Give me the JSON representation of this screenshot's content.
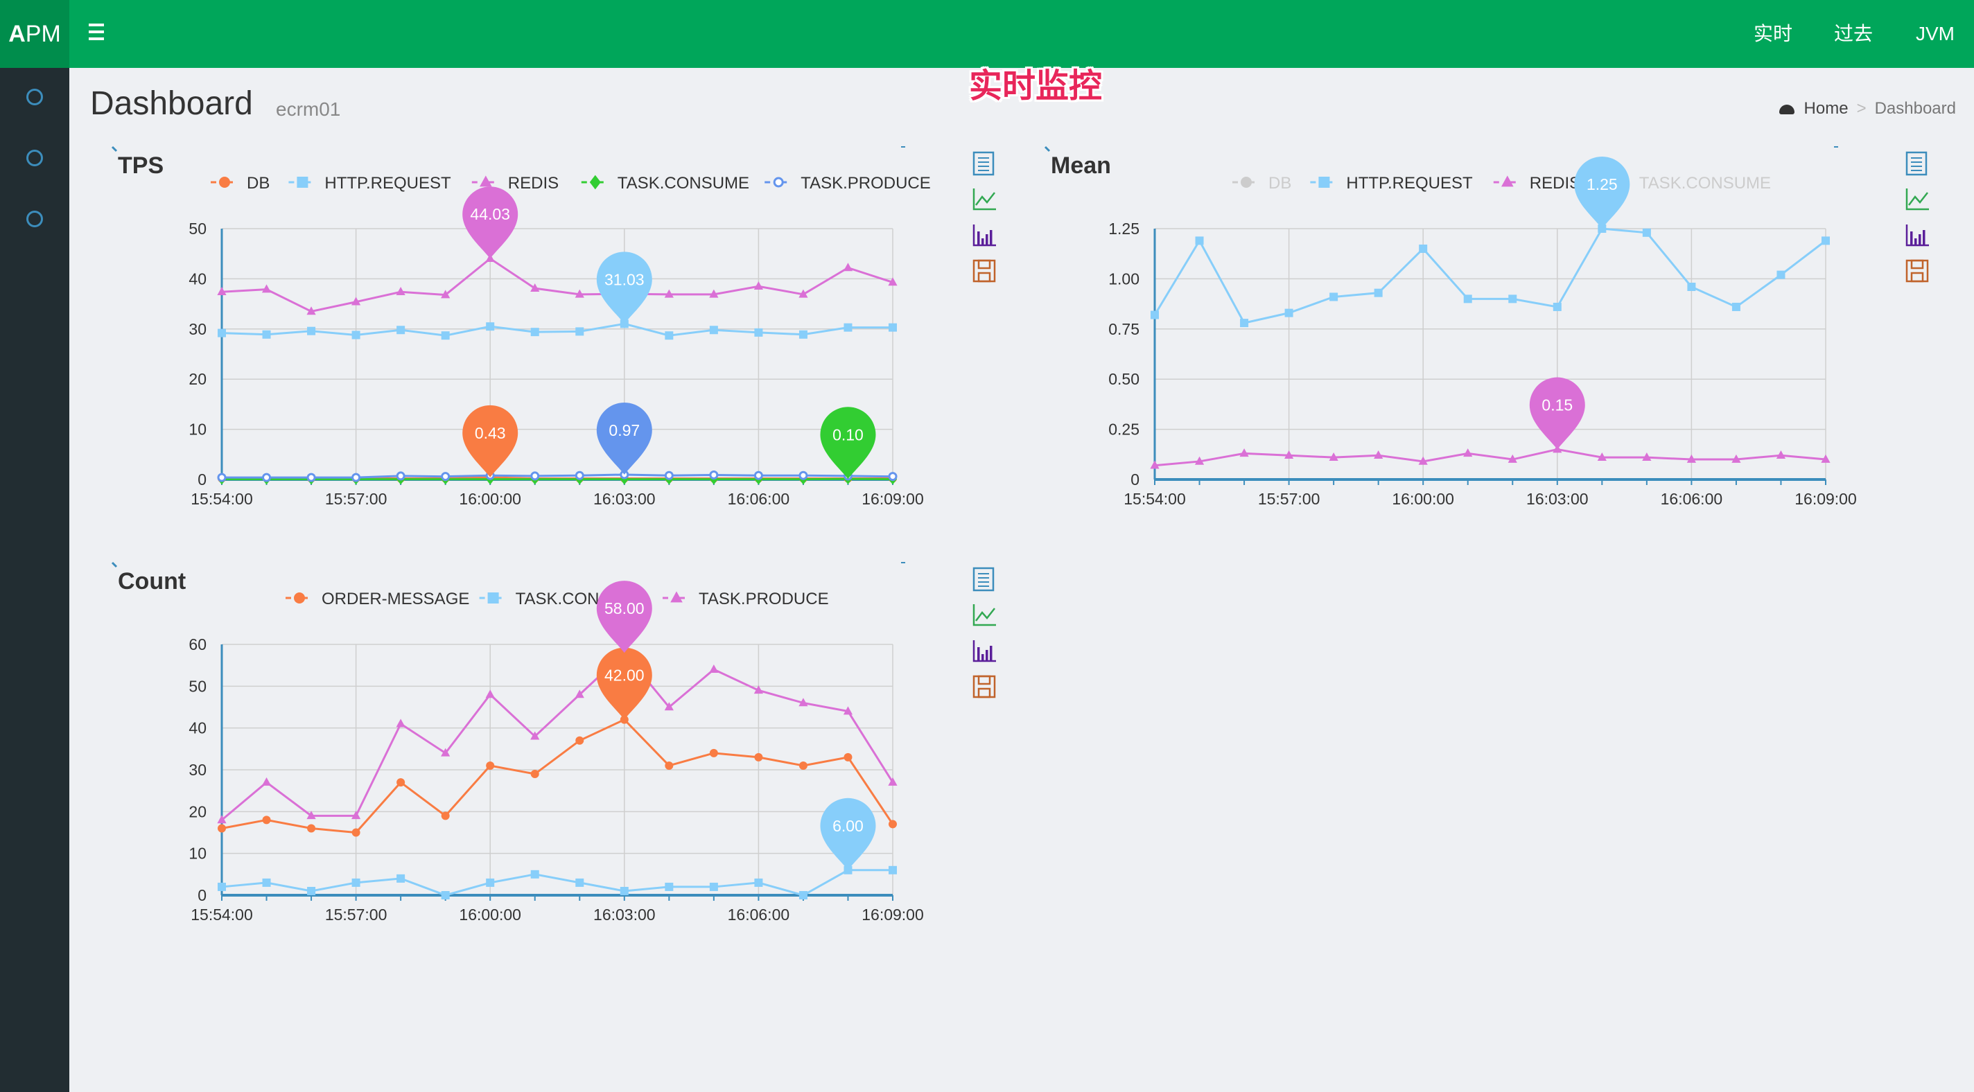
{
  "app": {
    "logo_a": "A",
    "logo_rest": "PM"
  },
  "nav": [
    "实时",
    "过去",
    "JVM"
  ],
  "overlay_label": "实时监控",
  "page": {
    "title": "Dashboard",
    "subtitle": "ecrm01"
  },
  "breadcrumb": {
    "home": "Home",
    "current": "Dashboard"
  },
  "toolbox": [
    "data-view-icon",
    "line-chart-icon",
    "bar-chart-icon",
    "save-image-icon"
  ],
  "chart_data": [
    {
      "id": "tps",
      "type": "line",
      "title": "TPS",
      "x": [
        "15:54:00",
        "15:55:00",
        "15:56:00",
        "15:57:00",
        "15:58:00",
        "15:59:00",
        "16:00:00",
        "16:01:00",
        "16:02:00",
        "16:03:00",
        "16:04:00",
        "16:05:00",
        "16:06:00",
        "16:07:00",
        "16:08:00",
        "16:09:00"
      ],
      "x_tick_labels": [
        "15:54:00",
        "15:57:00",
        "16:00:00",
        "16:03:00",
        "16:06:00",
        "16:09:00"
      ],
      "y_ticks": [
        "0",
        "10",
        "20",
        "30",
        "40",
        "50"
      ],
      "ylim": [
        0,
        50
      ],
      "grid": true,
      "legend_position": "top",
      "series": [
        {
          "name": "DB",
          "color": "#f97c43",
          "symbol": "circle",
          "hidden": false,
          "values": [
            0.2,
            0.3,
            0.2,
            0.2,
            0.2,
            0.2,
            0.43,
            0.2,
            0.2,
            0.2,
            0.2,
            0.2,
            0.2,
            0.2,
            0.2,
            0.2
          ],
          "marker": {
            "x_index": 6,
            "label": "0.43"
          }
        },
        {
          "name": "HTTP.REQUEST",
          "color": "#87cefa",
          "symbol": "square",
          "hidden": false,
          "values": [
            29.2,
            28.9,
            29.6,
            28.8,
            29.8,
            28.7,
            30.5,
            29.4,
            29.5,
            31.03,
            28.7,
            29.8,
            29.3,
            28.9,
            30.3,
            30.3
          ],
          "marker": {
            "x_index": 9,
            "label": "31.03"
          }
        },
        {
          "name": "REDIS",
          "color": "#da70d6",
          "symbol": "triangle",
          "hidden": false,
          "values": [
            37.4,
            37.9,
            33.5,
            35.4,
            37.4,
            36.8,
            44.03,
            38.1,
            36.9,
            37.0,
            36.9,
            36.9,
            38.5,
            36.9,
            42.2,
            39.3
          ],
          "marker": {
            "x_index": 6,
            "label": "44.03"
          }
        },
        {
          "name": "TASK.CONSUME",
          "color": "#32cd32",
          "symbol": "diamond",
          "hidden": false,
          "values": [
            0.05,
            0.05,
            0.05,
            0.05,
            0.05,
            0.05,
            0.05,
            0.05,
            0.05,
            0.05,
            0.05,
            0.05,
            0.05,
            0.05,
            0.1,
            0.05
          ],
          "marker": {
            "x_index": 14,
            "label": "0.10"
          }
        },
        {
          "name": "TASK.PRODUCE",
          "color": "#6495ed",
          "symbol": "emptyCircle",
          "hidden": false,
          "values": [
            0.4,
            0.4,
            0.4,
            0.4,
            0.7,
            0.6,
            0.8,
            0.7,
            0.8,
            0.97,
            0.8,
            0.9,
            0.8,
            0.8,
            0.7,
            0.6
          ],
          "marker": {
            "x_index": 9,
            "label": "0.97"
          }
        }
      ]
    },
    {
      "id": "mean",
      "type": "line",
      "title": "Mean",
      "x": [
        "15:54:00",
        "15:55:00",
        "15:56:00",
        "15:57:00",
        "15:58:00",
        "15:59:00",
        "16:00:00",
        "16:01:00",
        "16:02:00",
        "16:03:00",
        "16:04:00",
        "16:05:00",
        "16:06:00",
        "16:07:00",
        "16:08:00",
        "16:09:00"
      ],
      "x_tick_labels": [
        "15:54:00",
        "15:57:00",
        "16:00:00",
        "16:03:00",
        "16:06:00",
        "16:09:00"
      ],
      "y_ticks": [
        "0",
        "0.25",
        "0.50",
        "0.75",
        "1.00",
        "1.25"
      ],
      "ylim": [
        0,
        1.25
      ],
      "grid": true,
      "legend_position": "top",
      "series": [
        {
          "name": "DB",
          "color": "#f97c43",
          "symbol": "circle",
          "hidden": true,
          "values": []
        },
        {
          "name": "HTTP.REQUEST",
          "color": "#87cefa",
          "symbol": "square",
          "hidden": false,
          "values": [
            0.82,
            1.19,
            0.78,
            0.83,
            0.91,
            0.93,
            1.15,
            0.9,
            0.9,
            0.86,
            1.25,
            1.23,
            0.96,
            0.86,
            1.02,
            1.19
          ],
          "marker": {
            "x_index": 10,
            "label": "1.25"
          }
        },
        {
          "name": "REDIS",
          "color": "#da70d6",
          "symbol": "triangle",
          "hidden": false,
          "values": [
            0.07,
            0.09,
            0.13,
            0.12,
            0.11,
            0.12,
            0.09,
            0.13,
            0.1,
            0.15,
            0.11,
            0.11,
            0.1,
            0.1,
            0.12,
            0.1
          ],
          "marker": {
            "x_index": 9,
            "label": "0.15"
          }
        },
        {
          "name": "TASK.CONSUME",
          "color": "#32cd32",
          "symbol": "circle",
          "hidden": true,
          "values": []
        }
      ]
    },
    {
      "id": "count",
      "type": "line",
      "title": "Count",
      "x": [
        "15:54:00",
        "15:55:00",
        "15:56:00",
        "15:57:00",
        "15:58:00",
        "15:59:00",
        "16:00:00",
        "16:01:00",
        "16:02:00",
        "16:03:00",
        "16:04:00",
        "16:05:00",
        "16:06:00",
        "16:07:00",
        "16:08:00",
        "16:09:00"
      ],
      "x_tick_labels": [
        "15:54:00",
        "15:57:00",
        "16:00:00",
        "16:03:00",
        "16:06:00",
        "16:09:00"
      ],
      "y_ticks": [
        "0",
        "10",
        "20",
        "30",
        "40",
        "50",
        "60"
      ],
      "ylim": [
        0,
        60
      ],
      "grid": true,
      "legend_position": "top",
      "series": [
        {
          "name": "ORDER-MESSAGE",
          "color": "#f97c43",
          "symbol": "circle",
          "hidden": false,
          "values": [
            16,
            18,
            16,
            15,
            27,
            19,
            31,
            29,
            37,
            42,
            31,
            34,
            33,
            31,
            33,
            17
          ],
          "marker": {
            "x_index": 9,
            "label": "42.00"
          }
        },
        {
          "name": "TASK.CONSUME",
          "color": "#87cefa",
          "symbol": "square",
          "hidden": false,
          "values": [
            2,
            3,
            1,
            3,
            4,
            0,
            3,
            5,
            3,
            1,
            2,
            2,
            3,
            0,
            6,
            6
          ],
          "marker": {
            "x_index": 14,
            "label": "6.00"
          }
        },
        {
          "name": "TASK.PRODUCE",
          "color": "#da70d6",
          "symbol": "triangle",
          "hidden": false,
          "values": [
            18,
            27,
            19,
            19,
            41,
            34,
            48,
            38,
            48,
            58,
            45,
            54,
            49,
            46,
            44,
            27
          ],
          "marker": {
            "x_index": 9,
            "label": "58.00"
          }
        }
      ]
    }
  ]
}
